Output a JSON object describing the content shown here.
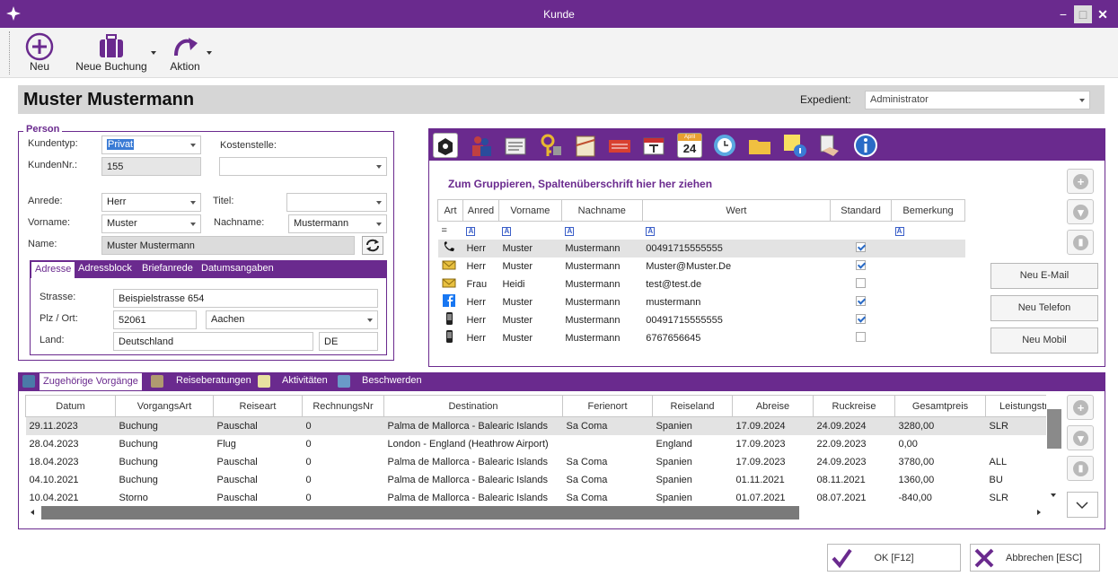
{
  "window": {
    "title": "Kunde",
    "minimize": "−",
    "maximize": "□",
    "close": "✕"
  },
  "toolbar": {
    "neu": "Neu",
    "neue_buchung": "Neue Buchung",
    "aktion": "Aktion"
  },
  "header": {
    "customer_name": "Muster Mustermann",
    "expedient_label": "Expedient:",
    "expedient_value": "Administrator"
  },
  "person": {
    "legend": "Person",
    "kundentyp_label": "Kundentyp:",
    "kundentyp_value": "Privat",
    "kostenstelle_label": "Kostenstelle:",
    "kostenstelle_value": "",
    "kundennr_label": "KundenNr.:",
    "kundennr_value": "155",
    "anrede_label": "Anrede:",
    "anrede_value": "Herr",
    "titel_label": "Titel:",
    "titel_value": "",
    "vorname_label": "Vorname:",
    "vorname_value": "Muster",
    "nachname_label": "Nachname:",
    "nachname_value": "Mustermann",
    "name_label": "Name:",
    "name_value": "Muster Mustermann"
  },
  "address": {
    "tabs": [
      "Adresse",
      "Adressblock",
      "Briefanrede",
      "Datumsangaben"
    ],
    "strasse_label": "Strasse:",
    "strasse_value": "Beispielstrasse 654",
    "plz_label": "Plz / Ort:",
    "plz_value": "52061",
    "ort_value": "Aachen",
    "land_label": "Land:",
    "land_value": "Deutschland",
    "land_code": "DE"
  },
  "contacts": {
    "group_hint": "Zum Gruppieren, Spaltenüberschrift hier her ziehen",
    "calendar_month": "April",
    "calendar_day": "24",
    "columns": [
      "Art",
      "Anred",
      "Vorname",
      "Nachname",
      "Wert",
      "Standard",
      "Bemerkung"
    ],
    "filter_eq": "=",
    "filter_a": "A",
    "rows": [
      {
        "art": "phone",
        "anrede": "Herr",
        "vorname": "Muster",
        "nachname": "Mustermann",
        "wert": "00491715555555",
        "standard": true
      },
      {
        "art": "email",
        "anrede": "Herr",
        "vorname": "Muster",
        "nachname": "Mustermann",
        "wert": "Muster@Muster.De",
        "standard": true
      },
      {
        "art": "email",
        "anrede": "Frau",
        "vorname": "Heidi",
        "nachname": "Mustermann",
        "wert": "test@test.de",
        "standard": false
      },
      {
        "art": "facebook",
        "anrede": "Herr",
        "vorname": "Muster",
        "nachname": "Mustermann",
        "wert": "mustermann",
        "standard": true
      },
      {
        "art": "mobile",
        "anrede": "Herr",
        "vorname": "Muster",
        "nachname": "Mustermann",
        "wert": "00491715555555",
        "standard": true
      },
      {
        "art": "mobile",
        "anrede": "Herr",
        "vorname": "Muster",
        "nachname": "Mustermann",
        "wert": "6767656645",
        "standard": false
      }
    ],
    "neu_email": "Neu E-Mail",
    "neu_telefon": "Neu Telefon",
    "neu_mobil": "Neu Mobil"
  },
  "bookings": {
    "tabs": [
      "Zugehörige Vorgänge",
      "Reiseberatungen",
      "Aktivitäten",
      "Beschwerden"
    ],
    "columns": [
      "Datum",
      "VorgangsArt",
      "Reiseart",
      "RechnungsNr",
      "Destination",
      "Ferienort",
      "Reiseland",
      "Abreise",
      "Ruckreise",
      "Gesamtpreis",
      "Leistungstra"
    ],
    "rows": [
      [
        "29.11.2023",
        "Buchung",
        "Pauschal",
        "0",
        "Palma de Mallorca - Balearic Islands",
        "Sa Coma",
        "Spanien",
        "17.09.2024",
        "24.09.2024",
        "3280,00",
        "SLR"
      ],
      [
        "28.04.2023",
        "Buchung",
        "Flug",
        "0",
        "London - England (Heathrow Airport)",
        "",
        "England",
        "17.09.2023",
        "22.09.2023",
        "0,00",
        ""
      ],
      [
        "18.04.2023",
        "Buchung",
        "Pauschal",
        "0",
        "Palma de Mallorca - Balearic Islands",
        "Sa Coma",
        "Spanien",
        "17.09.2023",
        "24.09.2023",
        "3780,00",
        "ALL"
      ],
      [
        "04.10.2021",
        "Buchung",
        "Pauschal",
        "0",
        "Palma de Mallorca - Balearic Islands",
        "Sa Coma",
        "Spanien",
        "01.11.2021",
        "08.11.2021",
        "1360,00",
        "BU"
      ],
      [
        "10.04.2021",
        "Storno",
        "Pauschal",
        "0",
        "Palma de Mallorca - Balearic Islands",
        "Sa Coma",
        "Spanien",
        "01.07.2021",
        "08.07.2021",
        "-840,00",
        "SLR"
      ]
    ]
  },
  "footer": {
    "ok": "OK [F12]",
    "cancel": "Abbrechen [ESC]"
  }
}
